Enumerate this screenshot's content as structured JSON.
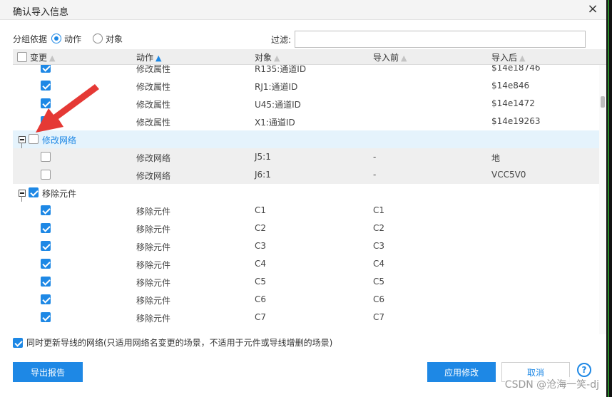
{
  "dialog": {
    "title": "确认导入信息",
    "close_glyph": "×"
  },
  "group_by": {
    "label": "分组依据",
    "options": [
      "动作",
      "对象"
    ],
    "selected": "动作"
  },
  "filter": {
    "label": "过滤:",
    "value": ""
  },
  "table": {
    "headers": [
      "变更",
      "动作",
      "对象",
      "导入前",
      "导入后"
    ],
    "sort_column": "动作",
    "rows": [
      {
        "type": "item",
        "checked": true,
        "action": "修改属性",
        "object": "R135:通道ID",
        "before": "",
        "after": "$14e18746"
      },
      {
        "type": "item",
        "checked": true,
        "action": "修改属性",
        "object": "RJ1:通道ID",
        "before": "",
        "after": "$14e846"
      },
      {
        "type": "item",
        "checked": true,
        "action": "修改属性",
        "object": "U45:通道ID",
        "before": "",
        "after": "$14e1472"
      },
      {
        "type": "item",
        "checked": true,
        "action": "修改属性",
        "object": "X1:通道ID",
        "before": "",
        "after": "$14e19263"
      },
      {
        "type": "group",
        "checked": false,
        "label": "修改网络",
        "selected": true
      },
      {
        "type": "item",
        "checked": false,
        "action": "修改网络",
        "object": "J5:1",
        "before": "-",
        "after": "地",
        "gray": true
      },
      {
        "type": "item",
        "checked": false,
        "action": "修改网络",
        "object": "J6:1",
        "before": "-",
        "after": "VCC5V0",
        "gray": true
      },
      {
        "type": "group",
        "checked": true,
        "label": "移除元件",
        "selected": false
      },
      {
        "type": "item",
        "checked": true,
        "action": "移除元件",
        "object": "C1",
        "before": "C1",
        "after": ""
      },
      {
        "type": "item",
        "checked": true,
        "action": "移除元件",
        "object": "C2",
        "before": "C2",
        "after": ""
      },
      {
        "type": "item",
        "checked": true,
        "action": "移除元件",
        "object": "C3",
        "before": "C3",
        "after": ""
      },
      {
        "type": "item",
        "checked": true,
        "action": "移除元件",
        "object": "C4",
        "before": "C4",
        "after": ""
      },
      {
        "type": "item",
        "checked": true,
        "action": "移除元件",
        "object": "C5",
        "before": "C5",
        "after": ""
      },
      {
        "type": "item",
        "checked": true,
        "action": "移除元件",
        "object": "C6",
        "before": "C6",
        "after": ""
      },
      {
        "type": "item",
        "checked": true,
        "action": "移除元件",
        "object": "C7",
        "before": "C7",
        "after": ""
      }
    ]
  },
  "options": {
    "update_net_label": "同时更新导线的网络(只适用网络名变更的场景，不适用于元件或导线增删的场景)",
    "update_net_checked": true
  },
  "buttons": {
    "export_report": "导出报告",
    "apply": "应用修改",
    "cancel": "取消",
    "help": "?"
  },
  "watermark": "CSDN @沧海一笑-dj",
  "colors": {
    "accent": "#1e88e5",
    "annotation_arrow": "#e53935"
  }
}
